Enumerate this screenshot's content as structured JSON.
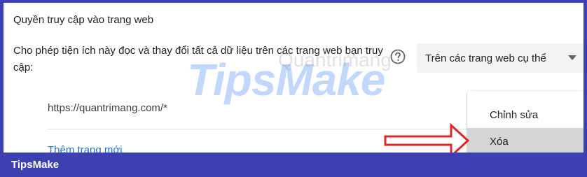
{
  "section": {
    "title": "Quyền truy cập vào trang web",
    "description": "Cho phép tiện ích này đọc và thay đổi tất cả dữ liệu trên các trang web bạn truy cập:"
  },
  "access_select": {
    "value": "Trên các trang web cụ thể"
  },
  "sites": [
    {
      "url": "https://quantrimang.com/*"
    }
  ],
  "add_site_label": "Thêm trang mới",
  "context_menu": {
    "items": [
      "Chỉnh sửa",
      "Xóa"
    ],
    "highlighted": "Xóa"
  },
  "watermark": {
    "text": "TipsMake",
    "sub": "Quantrimang"
  },
  "footer": {
    "brand": "TipsMake"
  },
  "colors": {
    "frame": "#3d40b0",
    "link": "#1a73e8",
    "arrow": "#e0242a"
  }
}
